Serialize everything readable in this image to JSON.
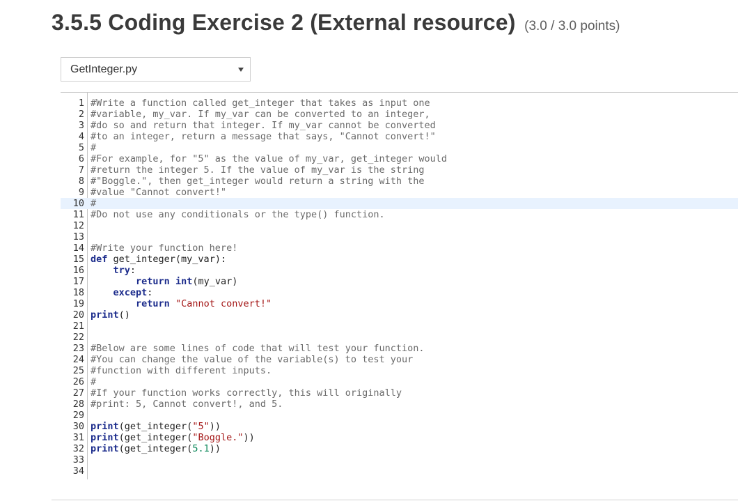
{
  "header": {
    "title": "3.5.5 Coding Exercise 2 (External resource)",
    "points": "(3.0 / 3.0 points)"
  },
  "file_select": {
    "value": "GetInteger.py",
    "icon": "caret-down-icon"
  },
  "editor": {
    "active_line": 10,
    "lines": [
      {
        "n": "1",
        "parts": [
          [
            "comment",
            "#Write a function called get_integer that takes as input one"
          ]
        ]
      },
      {
        "n": "2",
        "parts": [
          [
            "comment",
            "#variable, my_var. If my_var can be converted to an integer,"
          ]
        ]
      },
      {
        "n": "3",
        "parts": [
          [
            "comment",
            "#do so and return that integer. If my_var cannot be converted"
          ]
        ]
      },
      {
        "n": "4",
        "parts": [
          [
            "comment",
            "#to an integer, return a message that says, \"Cannot convert!\""
          ]
        ]
      },
      {
        "n": "5",
        "parts": [
          [
            "comment",
            "#"
          ]
        ]
      },
      {
        "n": "6",
        "parts": [
          [
            "comment",
            "#For example, for \"5\" as the value of my_var, get_integer would"
          ]
        ]
      },
      {
        "n": "7",
        "parts": [
          [
            "comment",
            "#return the integer 5. If the value of my_var is the string"
          ]
        ]
      },
      {
        "n": "8",
        "parts": [
          [
            "comment",
            "#\"Boggle.\", then get_integer would return a string with the"
          ]
        ]
      },
      {
        "n": "9",
        "parts": [
          [
            "comment",
            "#value \"Cannot convert!\""
          ]
        ]
      },
      {
        "n": "10",
        "parts": [
          [
            "comment",
            "#"
          ]
        ]
      },
      {
        "n": "11",
        "parts": [
          [
            "comment",
            "#Do not use any conditionals or the type() function."
          ]
        ]
      },
      {
        "n": "12",
        "parts": []
      },
      {
        "n": "13",
        "parts": []
      },
      {
        "n": "14",
        "parts": [
          [
            "comment",
            "#Write your function here!"
          ]
        ]
      },
      {
        "n": "15",
        "parts": [
          [
            "kw",
            "def"
          ],
          [
            "plain",
            " get_integer(my_var):"
          ]
        ]
      },
      {
        "n": "16",
        "parts": [
          [
            "plain",
            "    "
          ],
          [
            "kw",
            "try"
          ],
          [
            "plain",
            ":"
          ]
        ]
      },
      {
        "n": "17",
        "parts": [
          [
            "plain",
            "        "
          ],
          [
            "kw",
            "return"
          ],
          [
            "plain",
            " "
          ],
          [
            "kw",
            "int"
          ],
          [
            "plain",
            "(my_var)"
          ]
        ]
      },
      {
        "n": "18",
        "parts": [
          [
            "plain",
            "    "
          ],
          [
            "kw",
            "except"
          ],
          [
            "plain",
            ":"
          ]
        ]
      },
      {
        "n": "19",
        "parts": [
          [
            "plain",
            "        "
          ],
          [
            "kw",
            "return"
          ],
          [
            "plain",
            " "
          ],
          [
            "str",
            "\"Cannot convert!\""
          ]
        ]
      },
      {
        "n": "20",
        "parts": [
          [
            "kw",
            "print"
          ],
          [
            "plain",
            "()"
          ]
        ]
      },
      {
        "n": "21",
        "parts": []
      },
      {
        "n": "22",
        "parts": []
      },
      {
        "n": "23",
        "parts": [
          [
            "comment",
            "#Below are some lines of code that will test your function."
          ]
        ]
      },
      {
        "n": "24",
        "parts": [
          [
            "comment",
            "#You can change the value of the variable(s) to test your"
          ]
        ]
      },
      {
        "n": "25",
        "parts": [
          [
            "comment",
            "#function with different inputs."
          ]
        ]
      },
      {
        "n": "26",
        "parts": [
          [
            "comment",
            "#"
          ]
        ]
      },
      {
        "n": "27",
        "parts": [
          [
            "comment",
            "#If your function works correctly, this will originally"
          ]
        ]
      },
      {
        "n": "28",
        "parts": [
          [
            "comment",
            "#print: 5, Cannot convert!, and 5."
          ]
        ]
      },
      {
        "n": "29",
        "parts": []
      },
      {
        "n": "30",
        "parts": [
          [
            "kw",
            "print"
          ],
          [
            "plain",
            "(get_integer("
          ],
          [
            "str",
            "\"5\""
          ],
          [
            "plain",
            "))"
          ]
        ]
      },
      {
        "n": "31",
        "parts": [
          [
            "kw",
            "print"
          ],
          [
            "plain",
            "(get_integer("
          ],
          [
            "str",
            "\"Boggle.\""
          ],
          [
            "plain",
            "))"
          ]
        ]
      },
      {
        "n": "32",
        "parts": [
          [
            "kw",
            "print"
          ],
          [
            "plain",
            "(get_integer("
          ],
          [
            "num",
            "5.1"
          ],
          [
            "plain",
            "))"
          ]
        ]
      },
      {
        "n": "33",
        "parts": []
      },
      {
        "n": "34",
        "parts": []
      }
    ]
  }
}
